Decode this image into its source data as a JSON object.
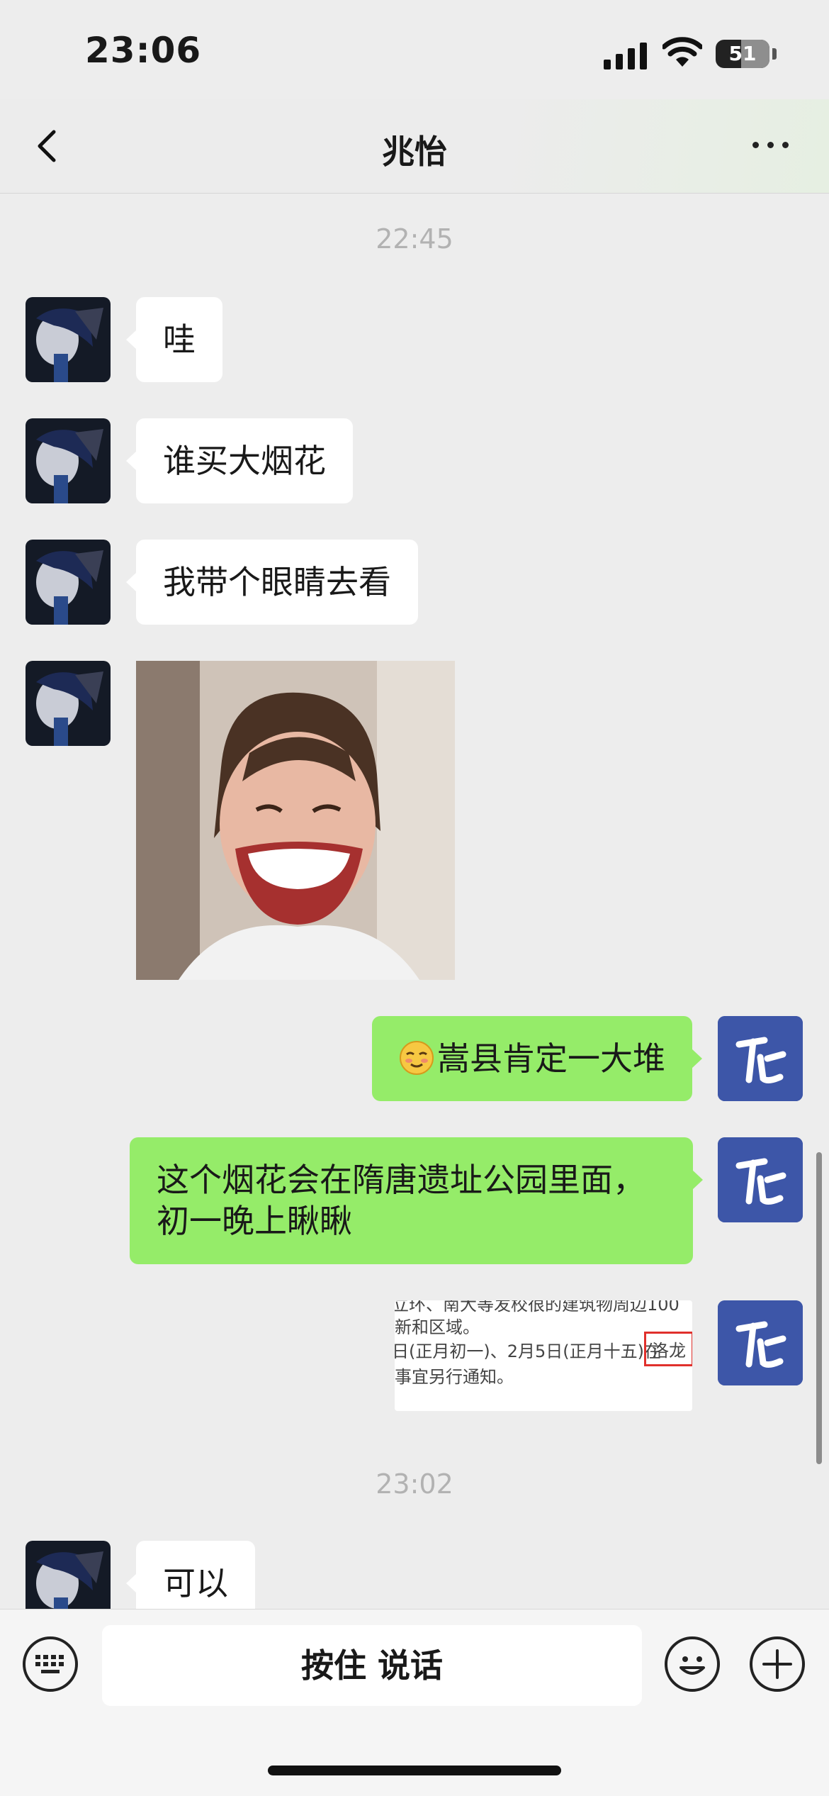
{
  "status_bar": {
    "time": "23:06",
    "battery": "51"
  },
  "nav": {
    "title": "兆怡",
    "back_icon": "chevron-left-icon",
    "more_icon": "ellipsis-icon"
  },
  "messages": {
    "time_1": "22:45",
    "m1": "哇",
    "m2": "谁买大烟花",
    "m3": "我带个眼睛去看",
    "m5_text": "嵩县肯定一大堆",
    "m6_line1": "这个烟花会在隋唐遗址公园里面，",
    "m6_line2": "初一晚上瞅瞅",
    "screenshot": {
      "line1": "立环、南大等发校很的建筑物周边100",
      "line2": "新和区域。",
      "line3_a": "日(正月初一)、2月5日(正月十五)在",
      "line3_b": "洛龙",
      "line4": "事宜另行通知。"
    },
    "time_2": "23:02",
    "m8": "可以"
  },
  "input_bar": {
    "voice_label": "按住 说话"
  },
  "colors": {
    "outgoing_bubble": "#95ec69",
    "incoming_bubble": "#ffffff",
    "background": "#ededed",
    "my_avatar": "#3d56a8"
  }
}
